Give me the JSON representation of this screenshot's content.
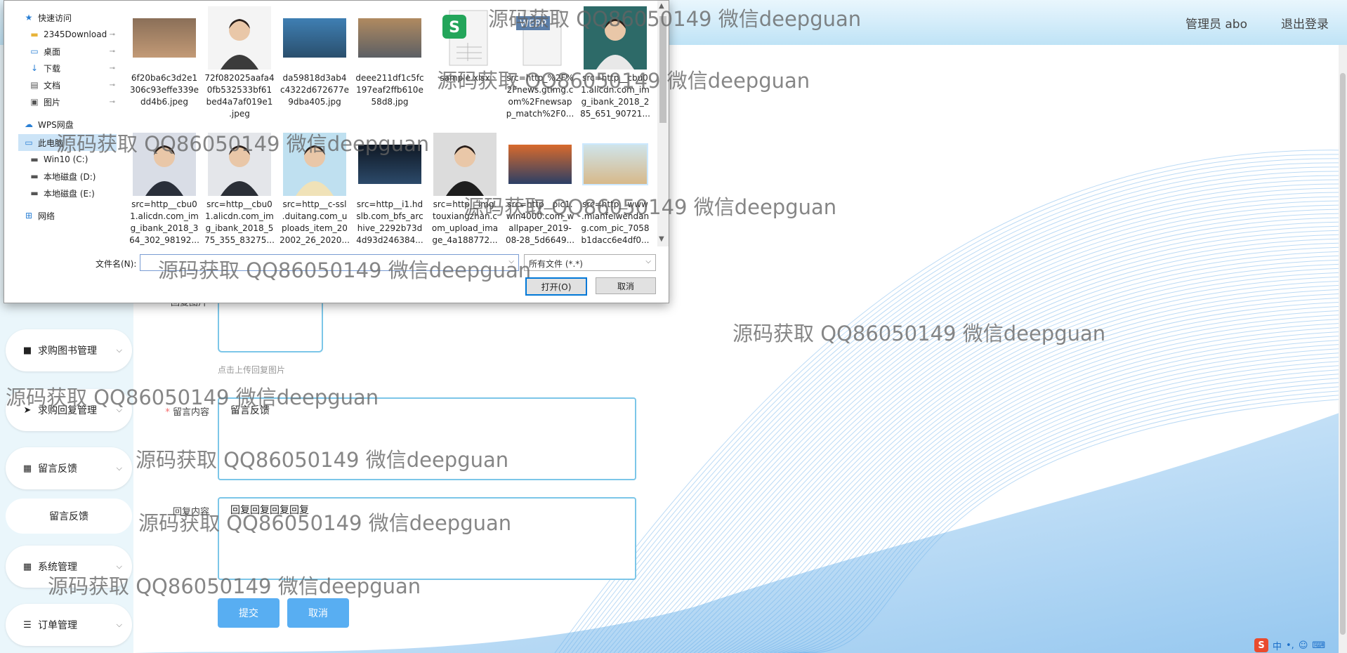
{
  "header": {
    "user_label": "管理员 abo",
    "logout_label": "退出登录"
  },
  "sidebar": {
    "items": [
      {
        "label": "求购图书管理",
        "icon": "book-icon"
      },
      {
        "label": "求购回复管理",
        "icon": "send-icon"
      },
      {
        "label": "留言反馈",
        "icon": "grid-icon"
      },
      {
        "label": "系统管理",
        "icon": "grid-icon"
      },
      {
        "label": "订单管理",
        "icon": "sliders-icon"
      }
    ],
    "sub_item": "留言反馈"
  },
  "form": {
    "upload_label": "回复图片",
    "upload_hint": "点击上传回复图片",
    "message_label": "留言内容",
    "message_value": "留言反馈",
    "reply_label": "回复内容",
    "reply_value": "回复回复回复回复",
    "submit_label": "提交",
    "cancel_label": "取消"
  },
  "file_dialog": {
    "nav": [
      {
        "label": "快速访问",
        "icon": "star-icon",
        "pinned": false,
        "indent": 0
      },
      {
        "label": "2345Download",
        "icon": "folder-icon",
        "pinned": true,
        "indent": 1
      },
      {
        "label": "桌面",
        "icon": "desktop-icon",
        "pinned": true,
        "indent": 1
      },
      {
        "label": "下载",
        "icon": "download-icon",
        "pinned": true,
        "indent": 1
      },
      {
        "label": "文档",
        "icon": "document-icon",
        "pinned": true,
        "indent": 1
      },
      {
        "label": "图片",
        "icon": "picture-icon",
        "pinned": true,
        "indent": 1
      },
      {
        "label": "WPS网盘",
        "icon": "cloud-icon",
        "pinned": false,
        "indent": 0
      },
      {
        "label": "此电脑",
        "icon": "computer-icon",
        "pinned": false,
        "indent": 0,
        "selected": true
      },
      {
        "label": "Win10 (C:)",
        "icon": "drive-icon",
        "pinned": false,
        "indent": 1
      },
      {
        "label": "本地磁盘 (D:)",
        "icon": "drive-icon",
        "pinned": false,
        "indent": 1
      },
      {
        "label": "本地磁盘 (E:)",
        "icon": "drive-icon",
        "pinned": false,
        "indent": 1
      },
      {
        "label": "网络",
        "icon": "network-icon",
        "pinned": false,
        "indent": 0
      }
    ],
    "files": [
      {
        "name": "6f20ba6c3d2e1306c93effe339edd4b6.jpeg",
        "lines": [
          "6f20ba6c3d2e1",
          "306c93effe339e",
          "dd4b6.jpeg"
        ],
        "kind": "photo",
        "colors": [
          "#8a6f58",
          "#c29a76"
        ]
      },
      {
        "name": "72f082025aafa40fb532533bf61bed4a7af019e1.jpeg",
        "lines": [
          "72f082025aafa4",
          "0fb532533bf61",
          "bed4a7af019e1",
          ".jpeg"
        ],
        "kind": "portrait",
        "colors": [
          "#f4f4f4",
          "#3b3b3b"
        ]
      },
      {
        "name": "da59818d3ab4c4322d672677e9dba405.jpg",
        "lines": [
          "da59818d3ab4",
          "c4322d672677e",
          "9dba405.jpg"
        ],
        "kind": "photo",
        "colors": [
          "#3f7fb3",
          "#2a4f6d"
        ]
      },
      {
        "name": "deee211df1c5fc197eaf2ffb610e58d8.jpg",
        "lines": [
          "deee211df1c5fc",
          "197eaf2ffb610e",
          "58d8.jpg"
        ],
        "kind": "photo",
        "colors": [
          "#b08a60",
          "#5c5f64"
        ]
      },
      {
        "name": "sample.xlsx",
        "lines": [
          "sample.xlsx"
        ],
        "kind": "sheet",
        "colors": [
          "#23a55a",
          "#ffffff"
        ]
      },
      {
        "name": "src=http_%2F%2Fnews.gtimg.com%2Fnewsapp_match%2F0...",
        "lines": [
          "src=http_%2F%",
          "2Fnews.gtimg.c",
          "om%2Fnewsap",
          "p_match%2F0..."
        ],
        "kind": "webp",
        "colors": [
          "#5b7ea8",
          "#ffffff"
        ]
      },
      {
        "name": "src=http__cbu01.alicdn.com_img_ibank_2018_285_651_90721...",
        "lines": [
          "src=http__cbu0",
          "1.alicdn.com_im",
          "g_ibank_2018_2",
          "85_651_90721..."
        ],
        "kind": "portrait",
        "colors": [
          "#2d6a68",
          "#e8e8e8"
        ]
      },
      {
        "name": "src=http__cbu01.alicdn.com_img_ibank_2018_364_302_98192...",
        "lines": [
          "src=http__cbu0",
          "1.alicdn.com_im",
          "g_ibank_2018_3",
          "64_302_98192..."
        ],
        "kind": "portrait",
        "colors": [
          "#d9dde6",
          "#2a2f3a"
        ]
      },
      {
        "name": "src=http__cbu01.alicdn.com_img_ibank_2018_575_355_83275...",
        "lines": [
          "src=http__cbu0",
          "1.alicdn.com_im",
          "g_ibank_2018_5",
          "75_355_83275..."
        ],
        "kind": "portrait",
        "colors": [
          "#e4e6ea",
          "#2b2f37"
        ]
      },
      {
        "name": "src=http__c-ssl.duitang.com_uploads_item_202002_26_2020...",
        "lines": [
          "src=http__c-ssl",
          ".duitang.com_u",
          "ploads_item_20",
          "2002_26_2020..."
        ],
        "kind": "portrait",
        "colors": [
          "#bfe0f0",
          "#f0e2b8"
        ]
      },
      {
        "name": "src=http__i1.hdslb.com_bfs_archive_2292b73d4d93d246384...",
        "lines": [
          "src=http__i1.hd",
          "slb.com_bfs_arc",
          "hive_2292b73d",
          "4d93d246384..."
        ],
        "kind": "photo",
        "colors": [
          "#0f1824",
          "#2c4a6a"
        ]
      },
      {
        "name": "src=http__img.touxiangzhan.com_upload_image_4a188772...",
        "lines": [
          "src=http__img.",
          "touxiangzhan.c",
          "om_upload_ima",
          "ge_4a188772..."
        ],
        "kind": "portrait",
        "colors": [
          "#dcdcdc",
          "#1e1e1e"
        ]
      },
      {
        "name": "src=http__pic1.win4000.com_wallpaper_2019-08-28_5d6649...",
        "lines": [
          "src=http__pic1.",
          "win4000.com_w",
          "allpaper_2019-",
          "08-28_5d6649..."
        ],
        "kind": "photo",
        "colors": [
          "#d86a2c",
          "#2b3f66"
        ]
      },
      {
        "name": "src=http__www.mianfeiwendang.com_pic_7058b1dacc6e4df0...",
        "lines": [
          "src=http__www",
          ".mianfeiwendan",
          "g.com_pic_7058",
          "b1dacc6e4df0..."
        ],
        "kind": "photo",
        "colors": [
          "#cfe4ea",
          "#d7b98a"
        ],
        "selected": true
      }
    ],
    "filename_label": "文件名(N):",
    "filename_value": "",
    "filter_value": "所有文件 (*.*)",
    "open_label": "打开(O)",
    "cancel_label": "取消"
  },
  "watermarks": [
    "源码获取 QQ86050149 微信deepguan",
    "源码获取 QQ86050149 微信deepguan",
    "源码获取 QQ86050149 微信deepguan",
    "源码获取 QQ86050149 微信deepguan",
    "源码获取 QQ86050149 微信deepguan",
    "源码获取 QQ86050149 微信deepguan",
    "源码获取 QQ86050149 微信deepguan",
    "源码获取 QQ86050149 微信deepguan",
    "源码获取 QQ86050149 微信deepguan",
    "源码获取 QQ86050149 微信deepguan"
  ],
  "tray": {
    "ime_logo": "S",
    "ime_text": "中"
  },
  "colors": {
    "accent": "#58aef2",
    "field_border": "#7cc6e8",
    "sidebar_bg": "#eaf6fb",
    "required": "#f56c6c"
  }
}
